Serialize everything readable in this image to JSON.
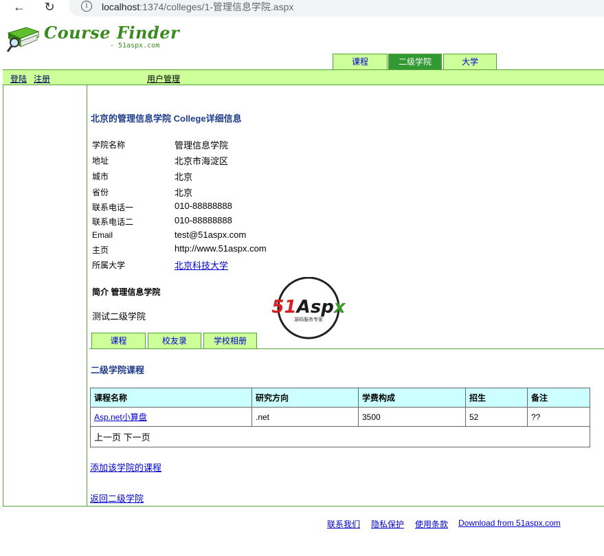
{
  "browser": {
    "url_host": "localhost",
    "url_path": ":1374/colleges/1-管理信息学院.aspx",
    "back_label": "←",
    "reload_label": "↻",
    "info_label": "i"
  },
  "header": {
    "logo_title": "Course Finder",
    "logo_subtitle": "- 51aspx.com",
    "tabs": [
      {
        "label": "课程"
      },
      {
        "label": "二级学院"
      },
      {
        "label": "大学"
      }
    ],
    "active_tab": "二级学院"
  },
  "userbar": {
    "login": "登陆",
    "register": "注册",
    "user_manage": "用户管理"
  },
  "college": {
    "title": "北京的管理信息学院 College详细信息",
    "fields": [
      {
        "label": "学院名称",
        "value": "管理信息学院"
      },
      {
        "label": "地址",
        "value": "北京市海淀区"
      },
      {
        "label": "城市",
        "value": "北京"
      },
      {
        "label": "省份",
        "value": "北京"
      },
      {
        "label": "联系电话一",
        "value": "010-88888888"
      },
      {
        "label": "联系电话二",
        "value": "010-88888888"
      },
      {
        "label": "Email",
        "value": "test@51aspx.com"
      },
      {
        "label": "主页",
        "value": "http://www.51aspx.com"
      },
      {
        "label": "所属大学",
        "value": "北京科技大学"
      }
    ],
    "intro_heading": "简介 管理信息学院",
    "intro_text": "测试二级学院"
  },
  "watermark": {
    "brand": "51Aspx",
    "tagline": "源码服务专家"
  },
  "subtabs": [
    {
      "label": "课程"
    },
    {
      "label": "校友录"
    },
    {
      "label": "学校相册"
    }
  ],
  "courses": {
    "heading": "二级学院课程",
    "columns": [
      "课程名称",
      "研究方向",
      "学费构成",
      "招生",
      "备注"
    ],
    "rows": [
      {
        "name": "Asp.net小算盘",
        "direction": ".net",
        "fee": "3500",
        "enroll": "52",
        "note": "??"
      }
    ],
    "pager": "上一页 下一页"
  },
  "links": {
    "add_course": "添加该学院的课程",
    "back": "返回二级学院"
  },
  "footer": {
    "contact": "联系我们",
    "privacy": "隐私保护",
    "terms": "使用条款",
    "download": "Download from 51aspx.com"
  },
  "colors": {
    "brand_green": "#3a8a1e",
    "tab_bg": "#ccff99",
    "tab_active_bg": "#339933",
    "table_header_bg": "#ccffff",
    "heading_blue": "#1f3c8a"
  }
}
